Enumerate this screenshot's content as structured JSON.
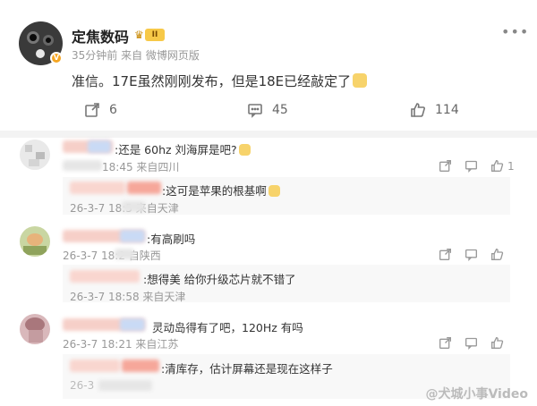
{
  "post": {
    "username": "定焦数码",
    "level": "II",
    "meta": "35分钟前 来自 微博网页版",
    "text": "准信。17E虽然刚刚发布，但是18E已经敲定了",
    "share_count": "6",
    "comment_count": "45",
    "like_count": "114"
  },
  "comments": [
    {
      "text": ":还是 60hz 刘海屏是吧?",
      "meta": "18:45 来自四川",
      "like_count": "1",
      "reply": {
        "text": ":这可是苹果的根基啊",
        "meta": "26-3-7 18:5  来自天津"
      }
    },
    {
      "text": ":有高刷吗",
      "meta": "26-3-7 18:2  自陕西",
      "reply": {
        "text": ":想得美  给你升级芯片就不错了",
        "meta": "26-3-7 18:58 来自天津"
      }
    },
    {
      "text": "灵动岛得有了吧，120Hz 有吗",
      "meta": "26-3-7 18:21 来自江苏",
      "reply": {
        "text": ":清库存，估计屏幕还是现在这样子",
        "meta": "26-3"
      }
    }
  ],
  "watermark": "@犬城小事Video",
  "colors": {
    "accent": "#f7c948",
    "muted": "#999999",
    "divider": "#f3f3f3"
  }
}
